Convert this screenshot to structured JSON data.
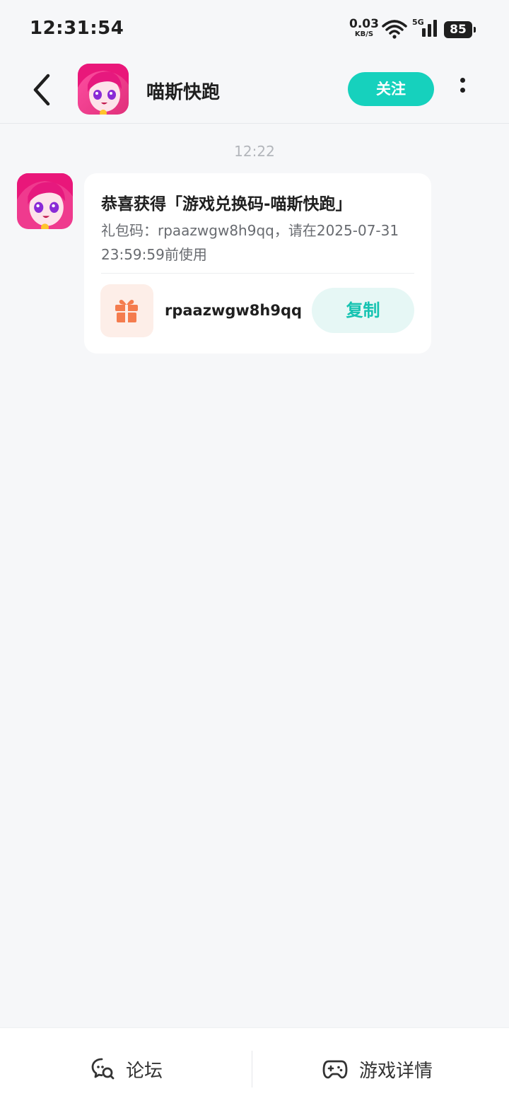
{
  "status_bar": {
    "time": "12:31:54",
    "net_speed": "0.03",
    "net_unit": "KB/S",
    "network_type": "5G",
    "battery": "85"
  },
  "header": {
    "title": "喵斯快跑",
    "follow_label": "关注"
  },
  "chat": {
    "time": "12:22",
    "message": {
      "title": "恭喜获得「游戏兑换码-喵斯快跑」",
      "description": "礼包码：rpaazwgw8h9qq，请在2025-07-31 23:59:59前使用",
      "code": "rpaazwgw8h9qq",
      "copy_label": "复制"
    }
  },
  "bottom_bar": {
    "forum_label": "论坛",
    "game_detail_label": "游戏详情"
  },
  "colors": {
    "accent": "#16d1bd",
    "copy_text": "#15c3b1",
    "gift": "#f47c4e"
  }
}
